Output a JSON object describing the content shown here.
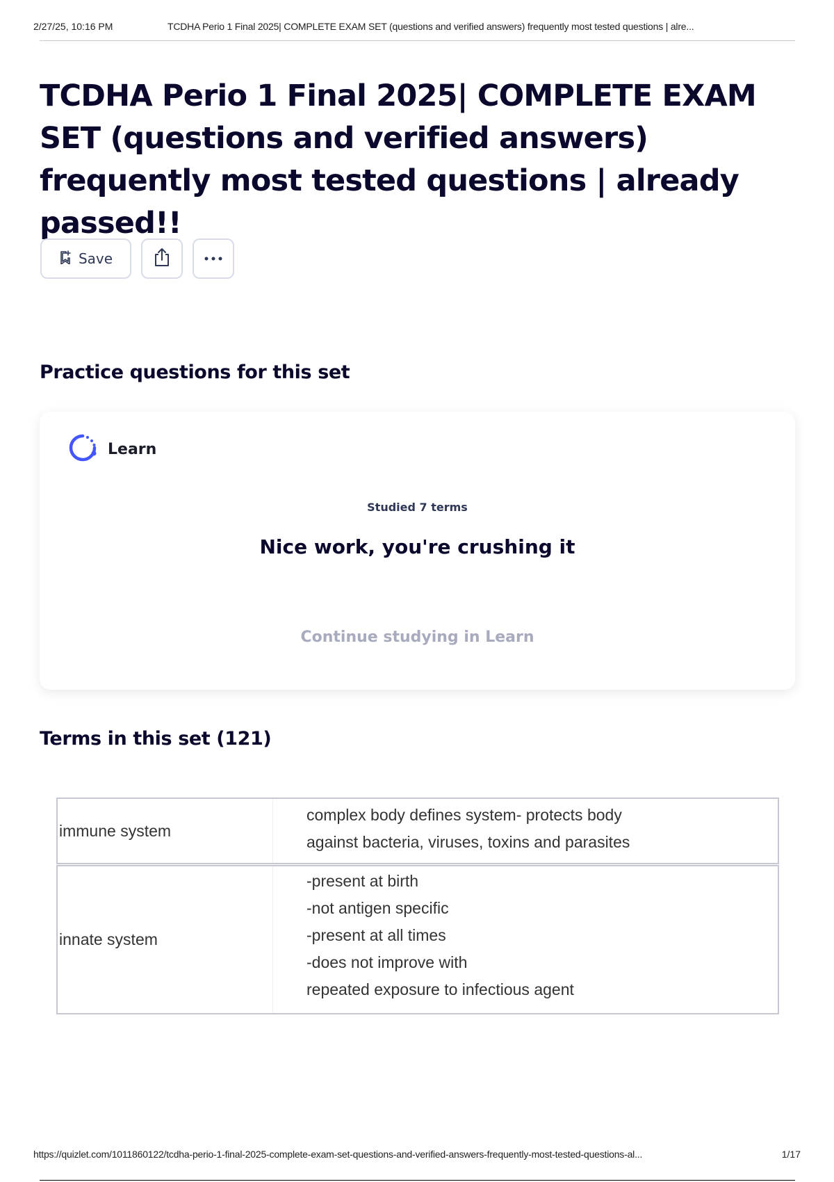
{
  "print_header": {
    "date": "2/27/25, 10:16 PM",
    "doc_title": "TCDHA Perio 1 Final 2025| COMPLETE EXAM SET (questions and verified answers) frequently most tested questions | alre..."
  },
  "page": {
    "title": "TCDHA Perio 1 Final 2025| COMPLETE EXAM SET (questions and verified answers) frequently most tested questions | already passed!!"
  },
  "actions": {
    "save_label": "Save",
    "save_icon": "bookmark-add-icon",
    "share_icon": "share-icon",
    "more_icon": "more-options-icon"
  },
  "practice": {
    "heading": "Practice questions for this set",
    "mode_label": "Learn",
    "mode_icon": "learn-progress-icon",
    "studied": "Studied 7 terms",
    "praise": "Nice work, you're crushing it",
    "continue_label": "Continue studying in Learn"
  },
  "terms": {
    "heading": "Terms in this set (121)",
    "rows": [
      {
        "term": "immune system",
        "definition_lines": [
          "complex body defines system- protects body",
          "against bacteria, viruses, toxins and parasites"
        ]
      },
      {
        "term": "innate system",
        "definition_lines": [
          "-present at birth",
          "-not antigen specific",
          "-present at all times",
          "-does not improve with",
          "repeated exposure to infectious agent"
        ]
      }
    ]
  },
  "print_footer": {
    "url": "https://quizlet.com/1011860122/tcdha-perio-1-final-2025-complete-exam-set-questions-and-verified-answers-frequently-most-tested-questions-al...",
    "page_num": "1/17"
  },
  "colors": {
    "accent": "#4255ff",
    "title": "#0a092d",
    "muted": "#a7abbd",
    "border": "#d9dde8"
  }
}
